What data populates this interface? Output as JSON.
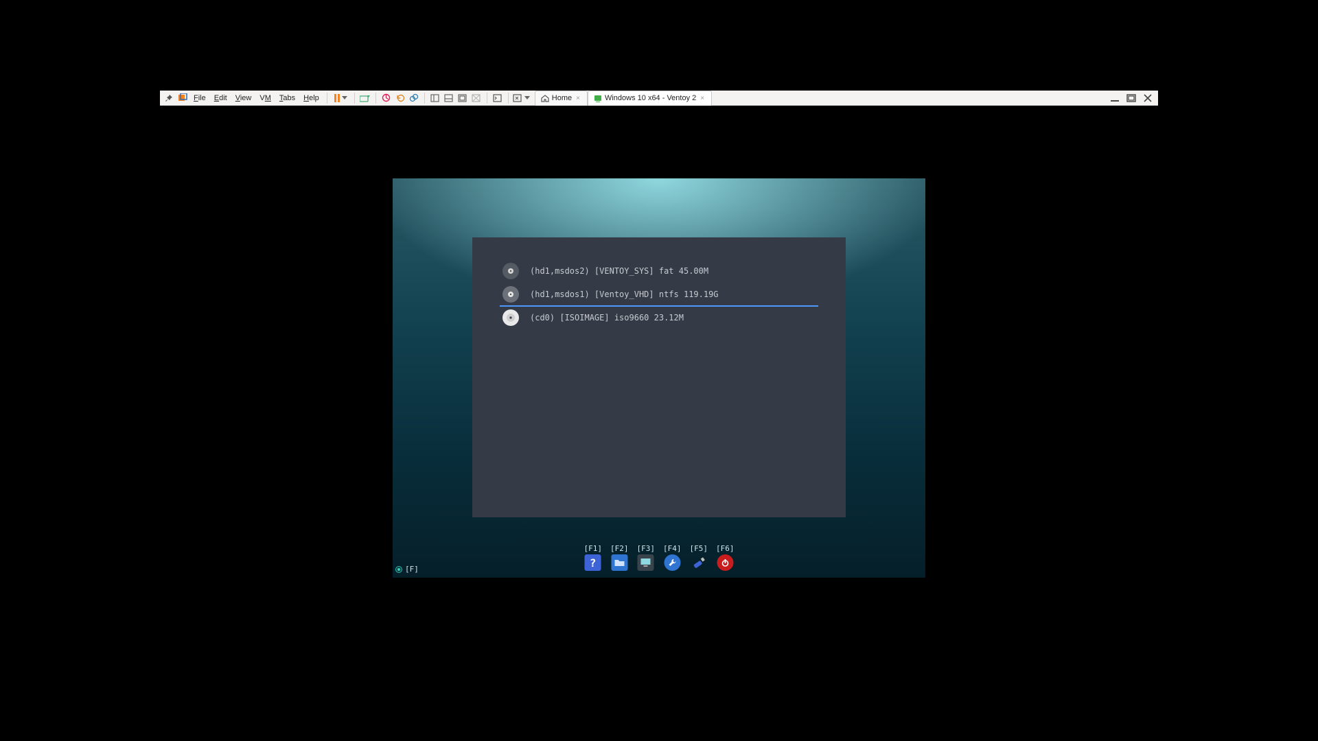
{
  "menu": {
    "file": "File",
    "edit": "Edit",
    "view": "View",
    "vm": "VM",
    "tabs": "Tabs",
    "help": "Help"
  },
  "tabs": {
    "home": "Home",
    "active": "Windows 10 x64 - Ventoy 2"
  },
  "boot_entries": [
    {
      "text": "(hd1,msdos2) [VENTOY_SYS] fat 45.00M",
      "kind": "hdd",
      "selected": false
    },
    {
      "text": "(hd1,msdos1) [Ventoy_VHD] ntfs 119.19G",
      "kind": "hdd",
      "selected": true
    },
    {
      "text": "(cd0) [ISOIMAGE] iso9660 23.12M",
      "kind": "cd",
      "selected": false
    }
  ],
  "dock": [
    {
      "key": "[F1]",
      "name": "help"
    },
    {
      "key": "[F2]",
      "name": "file-manager"
    },
    {
      "key": "[F3]",
      "name": "display"
    },
    {
      "key": "[F4]",
      "name": "tools"
    },
    {
      "key": "[F5]",
      "name": "usb"
    },
    {
      "key": "[F6]",
      "name": "power"
    }
  ],
  "status": {
    "left": "[F]"
  }
}
